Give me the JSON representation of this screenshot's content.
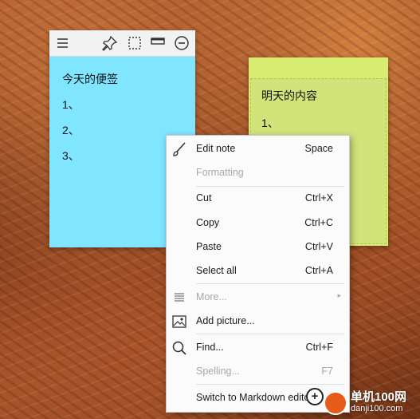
{
  "note_blue": {
    "background": "#80e5ff",
    "toolbar_icons": [
      "menu-icon",
      "pin-icon",
      "select-icon",
      "window-icon",
      "minimize-icon"
    ],
    "lines": [
      "今天的便签",
      "1、",
      "2、",
      "3、"
    ]
  },
  "note_green": {
    "background": "#d9ec72",
    "lines": [
      "明天的内容",
      "1、"
    ]
  },
  "context_menu": {
    "items": [
      {
        "label": "Edit note",
        "shortcut": "Space",
        "icon": "brush-icon",
        "disabled": false
      },
      {
        "label": "Formatting",
        "shortcut": "",
        "disabled": true
      },
      {
        "label": "Cut",
        "shortcut": "Ctrl+X",
        "disabled": false
      },
      {
        "label": "Copy",
        "shortcut": "Ctrl+C",
        "disabled": false
      },
      {
        "label": "Paste",
        "shortcut": "Ctrl+V",
        "disabled": false
      },
      {
        "label": "Select all",
        "shortcut": "Ctrl+A",
        "disabled": false
      },
      {
        "label": "More...",
        "shortcut": "",
        "icon": "list-icon",
        "disabled": true,
        "submenu": true
      },
      {
        "label": "Add picture...",
        "shortcut": "",
        "icon": "picture-icon",
        "disabled": false
      },
      {
        "label": "Find...",
        "shortcut": "Ctrl+F",
        "icon": "magnifier-icon",
        "disabled": false
      },
      {
        "label": "Spelling...",
        "shortcut": "F7",
        "disabled": true
      },
      {
        "label": "Switch to Markdown editor",
        "shortcut": "",
        "disabled": false
      }
    ]
  },
  "watermark": {
    "line1": "单机100网",
    "line2": "danji100.com"
  }
}
